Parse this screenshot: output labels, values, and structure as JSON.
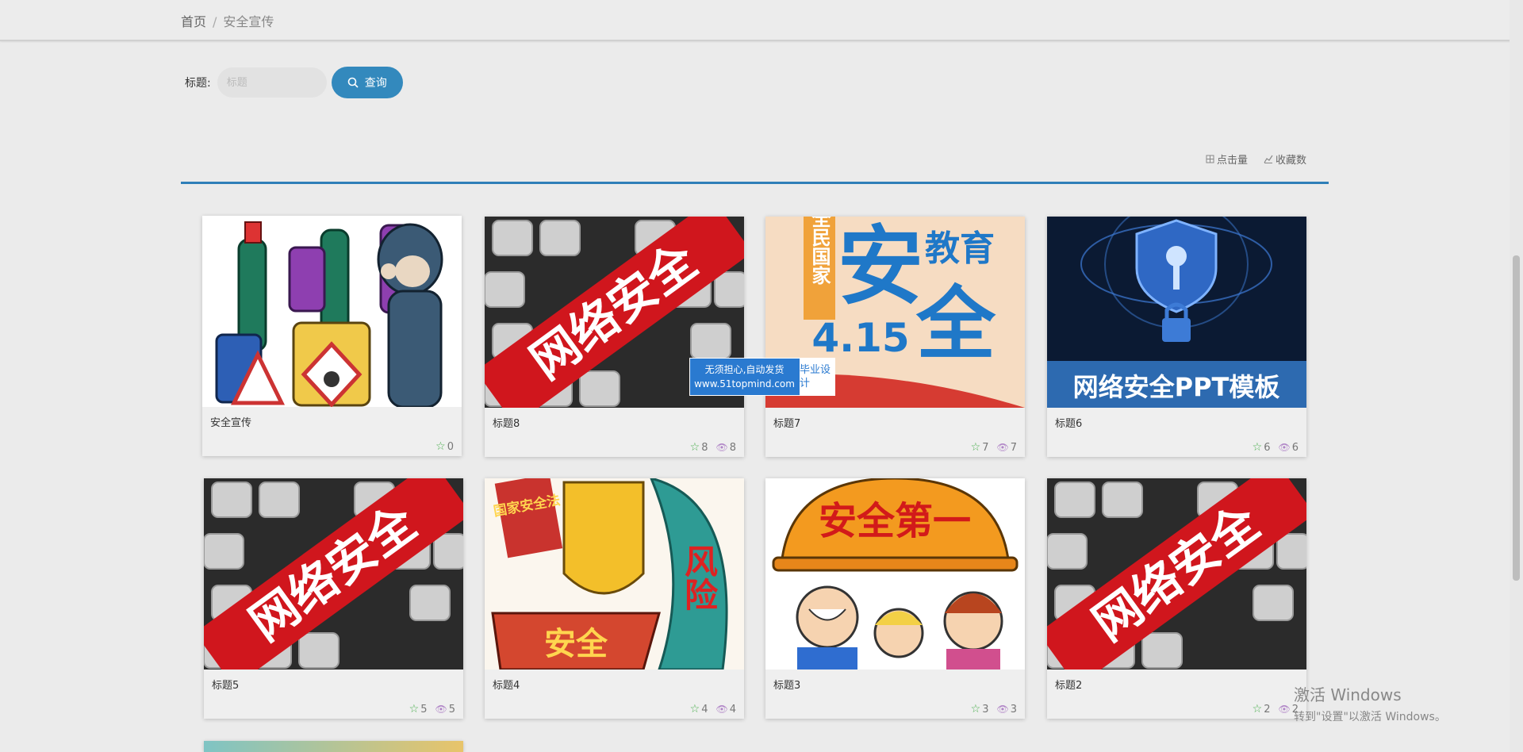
{
  "breadcrumb": {
    "home": "首页",
    "separator": "/",
    "current": "安全宣传"
  },
  "search": {
    "label": "标题:",
    "placeholder": "标题",
    "value": "",
    "button_label": "查询",
    "button_icon": "search-icon"
  },
  "sort": {
    "clicks_label": "点击量",
    "favorites_label": "收藏数"
  },
  "colors": {
    "accent": "#3389bd",
    "divider": "#2f7fb8",
    "star": "#4caf50",
    "eye": "#b186c7"
  },
  "cards": [
    {
      "title": "安全宣传",
      "favorites": "0",
      "views": null
    },
    {
      "title": "标题8",
      "favorites": "8",
      "views": "8"
    },
    {
      "title": "标题7",
      "favorites": "7",
      "views": "7"
    },
    {
      "title": "标题6",
      "favorites": "6",
      "views": "6"
    },
    {
      "title": "标题5",
      "favorites": "5",
      "views": "5"
    },
    {
      "title": "标题4",
      "favorites": "4",
      "views": "4"
    },
    {
      "title": "标题3",
      "favorites": "3",
      "views": "3"
    },
    {
      "title": "标题2",
      "favorites": "2",
      "views": "2"
    }
  ],
  "images": {
    "chemicals": {},
    "keyboard": {
      "text": "网络安全"
    },
    "national": {
      "left": "全民国家",
      "big": "安",
      "top": "教育",
      "big2": "全",
      "date": "4.15"
    },
    "shield": {
      "text": "网络安全PPT模板"
    },
    "law": {
      "banner": "国家安全法",
      "shield": "安全",
      "wave": "风险"
    },
    "helmet": {
      "text": "安全第一"
    }
  },
  "watermark": {
    "line1": "无须担心,自动发货",
    "line2": "www.51topmind.com",
    "side": "毕业设计"
  },
  "activation": {
    "title": "激活 Windows",
    "subtitle": "转到\"设置\"以激活 Windows。"
  }
}
